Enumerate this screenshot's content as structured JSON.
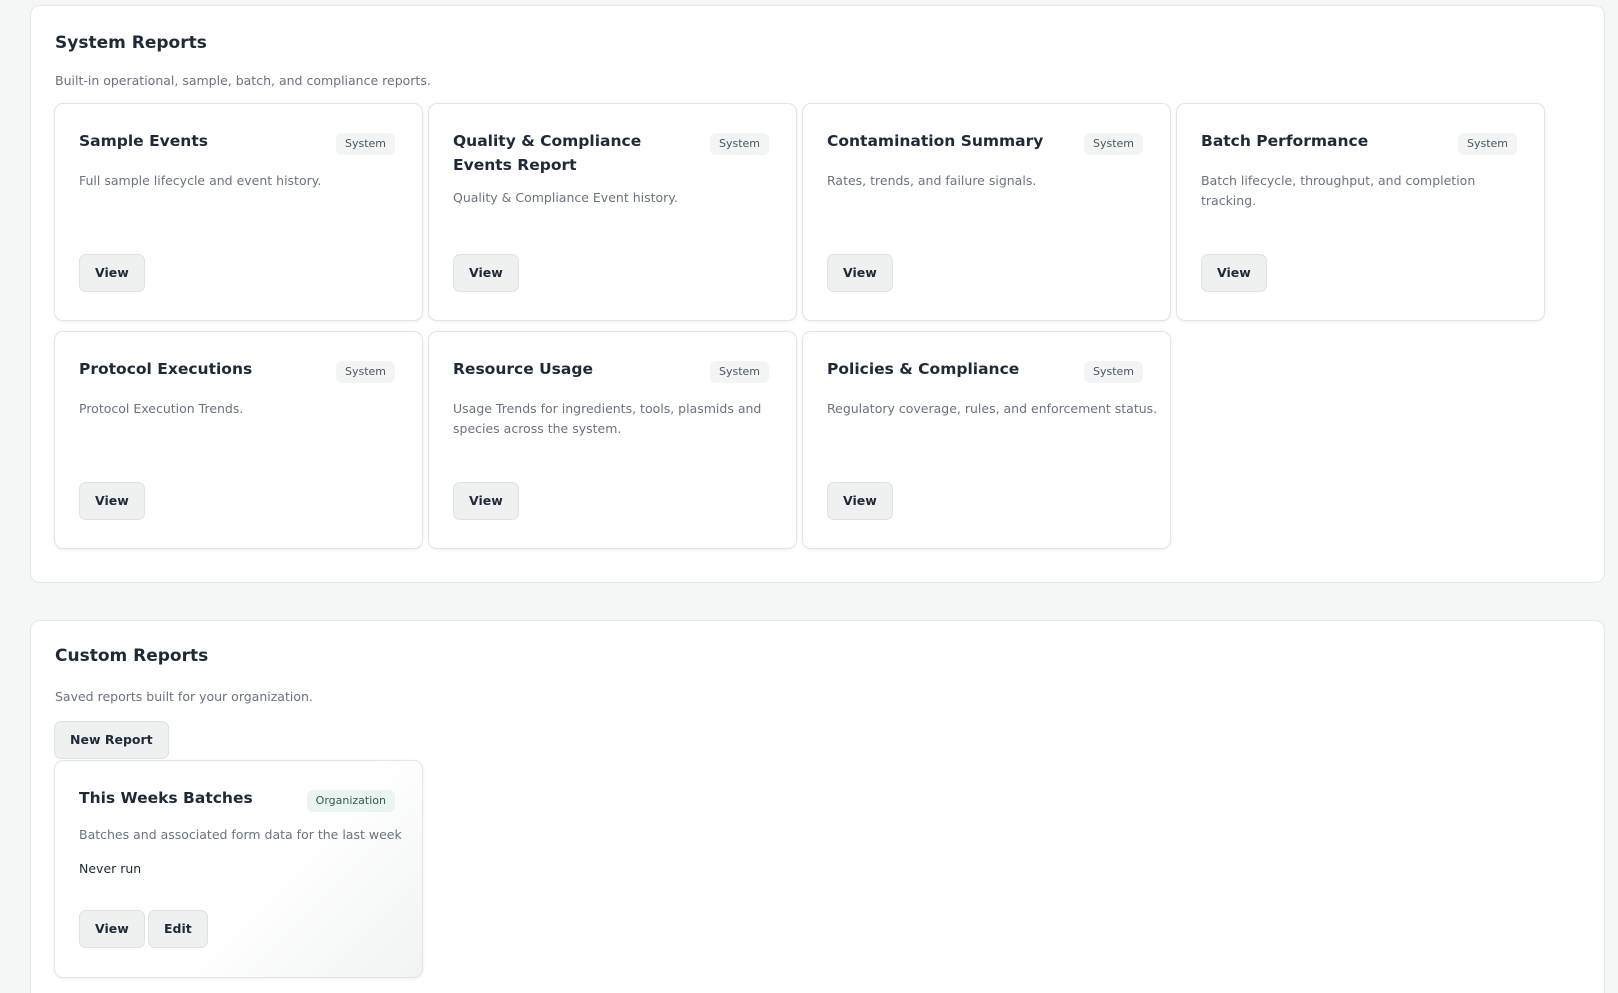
{
  "system_reports": {
    "title": "System Reports",
    "description": "Built-in operational, sample, batch, and compliance reports.",
    "cards": [
      {
        "title": "Sample Events",
        "badge": "System",
        "description": "Full sample lifecycle and event history.",
        "view_label": "View"
      },
      {
        "title": "Quality & Compliance Events Report",
        "badge": "System",
        "description": "Quality & Compliance Event history.",
        "view_label": "View"
      },
      {
        "title": "Contamination Summary",
        "badge": "System",
        "description": "Rates, trends, and failure signals.",
        "view_label": "View"
      },
      {
        "title": "Batch Performance",
        "badge": "System",
        "description": "Batch lifecycle, throughput, and completion tracking.",
        "view_label": "View"
      },
      {
        "title": "Protocol Executions",
        "badge": "System",
        "description": "Protocol Execution Trends.",
        "view_label": "View"
      },
      {
        "title": "Resource Usage",
        "badge": "System",
        "description": "Usage Trends for ingredients, tools, plasmids and species across the system.",
        "view_label": "View"
      },
      {
        "title": "Policies & Compliance",
        "badge": "System",
        "description": "Regulatory coverage, rules, and enforcement status.",
        "view_label": "View"
      }
    ]
  },
  "custom_reports": {
    "title": "Custom Reports",
    "description": "Saved reports built for your organization.",
    "new_report_label": "New Report",
    "cards": [
      {
        "title": "This Weeks Batches",
        "badge": "Organization",
        "description": "Batches and associated form data for the last week",
        "status": "Never run",
        "view_label": "View",
        "edit_label": "Edit"
      }
    ]
  }
}
